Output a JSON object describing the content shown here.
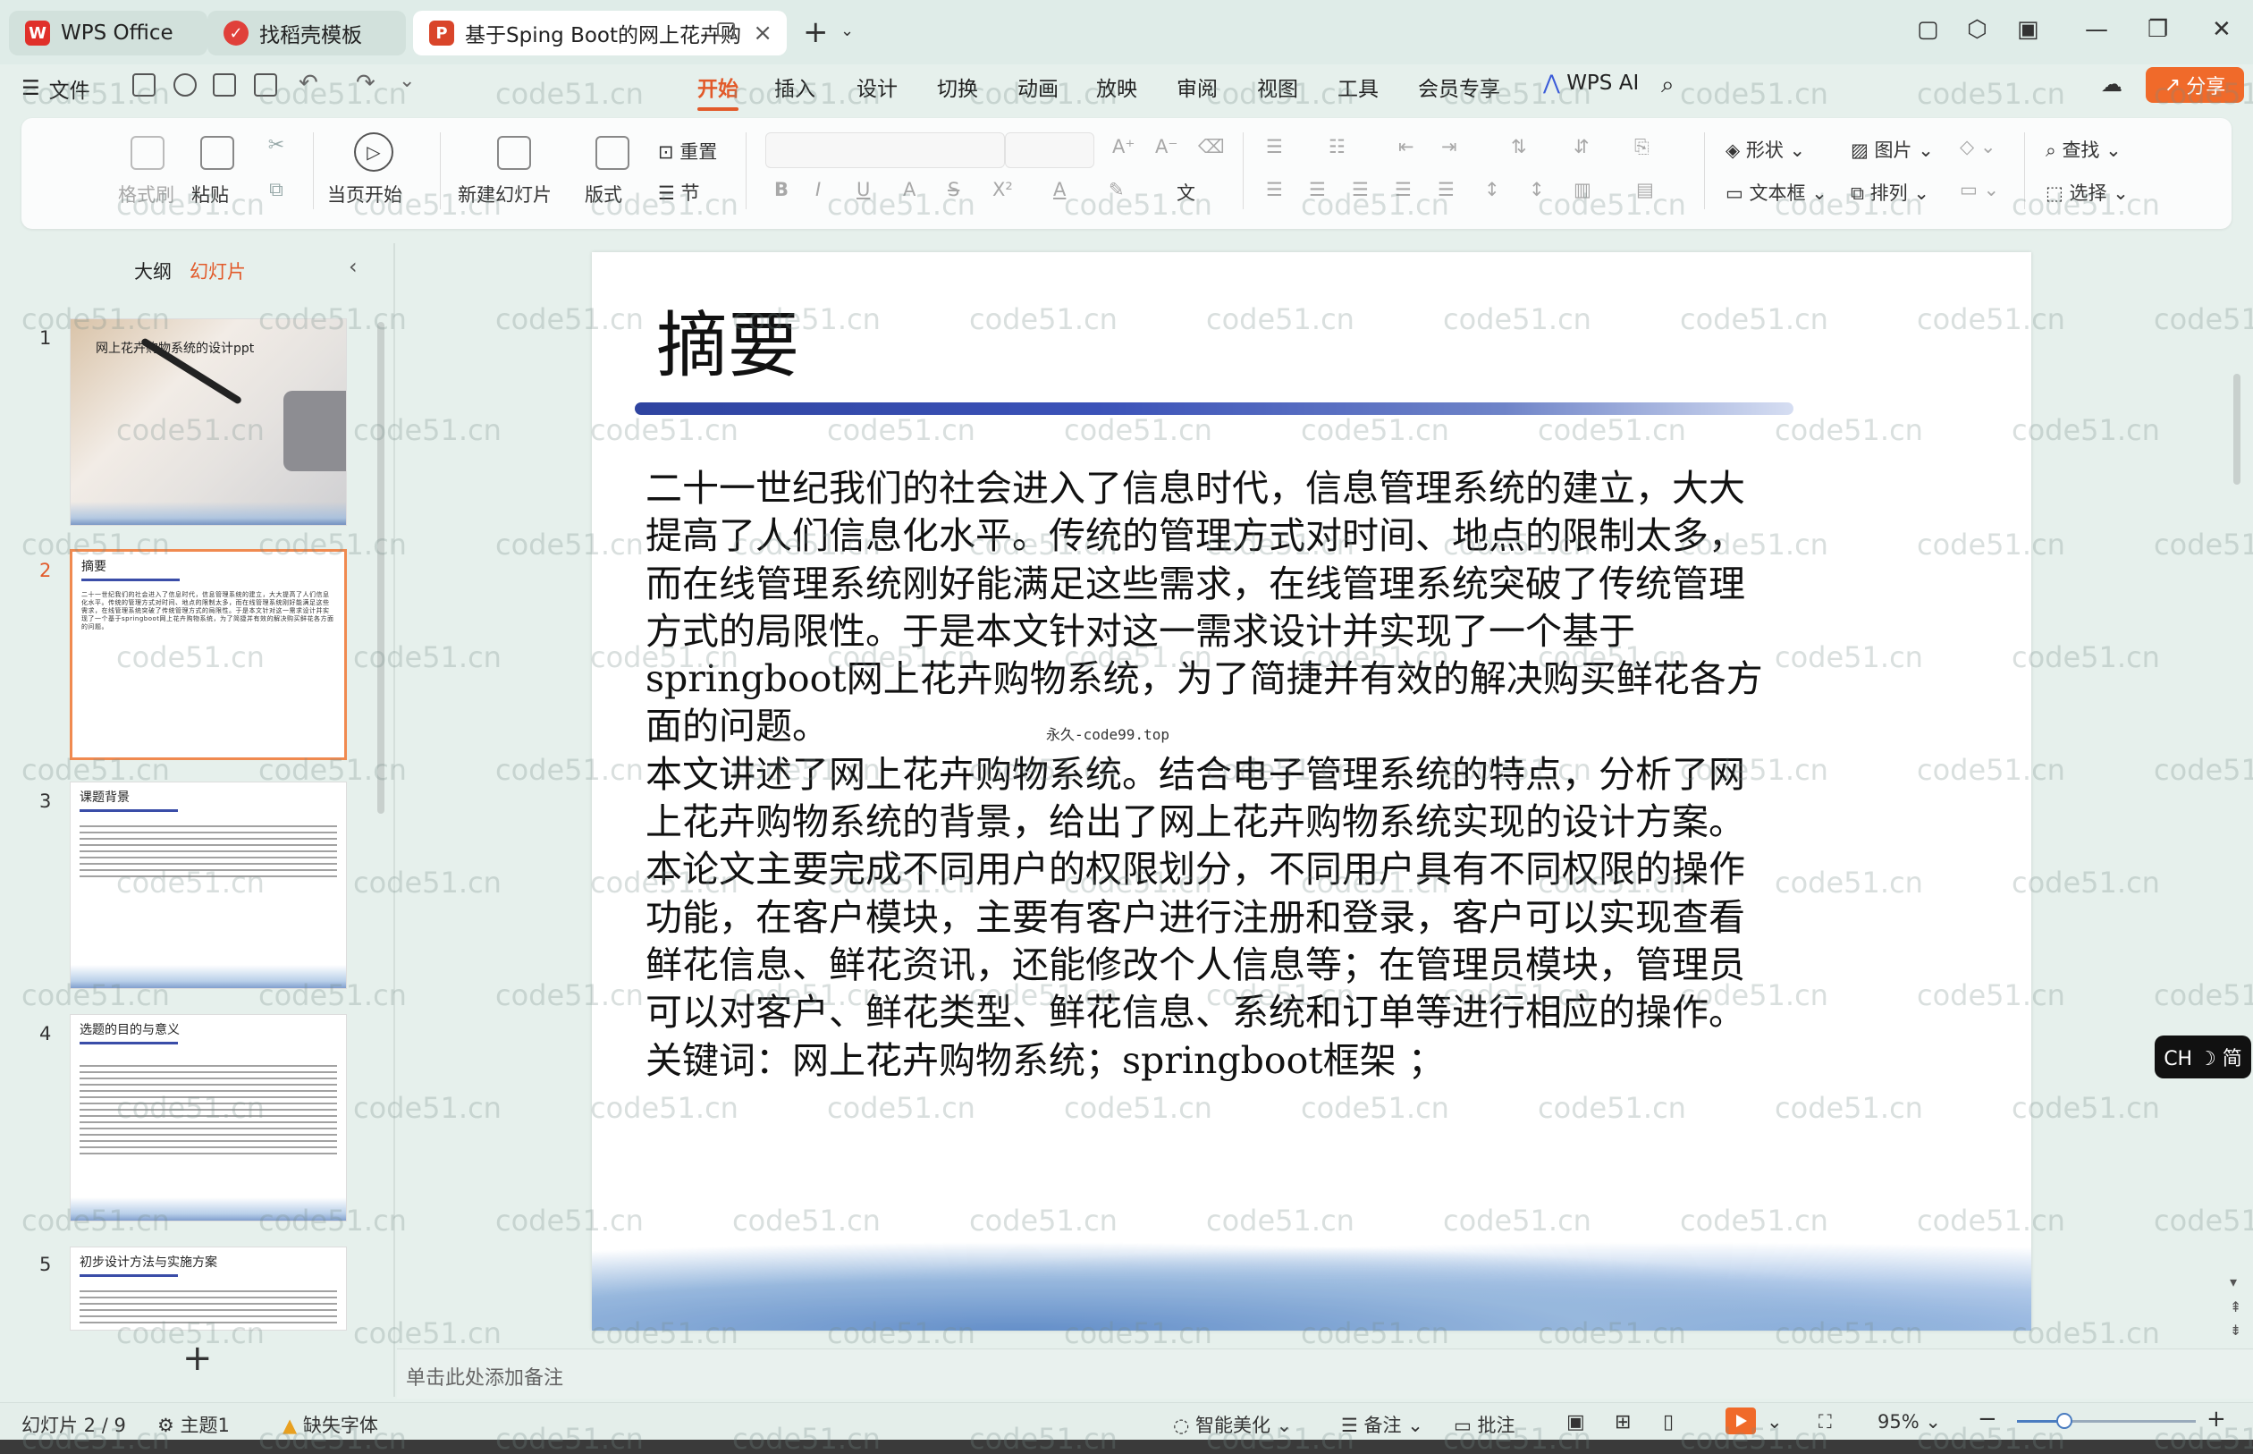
{
  "tabs": [
    {
      "label": "WPS Office",
      "icon": "wps-logo-icon"
    },
    {
      "label": "找稻壳模板",
      "icon": "docer-icon"
    },
    {
      "label": "基于Sping Boot的网上花卉购",
      "icon": "ppt-file-icon"
    }
  ],
  "menu": {
    "file_label": "文件",
    "tabs": [
      "开始",
      "插入",
      "设计",
      "切换",
      "动画",
      "放映",
      "审阅",
      "视图",
      "工具",
      "会员专享"
    ],
    "active_tab": "开始",
    "wps_ai": "WPS AI",
    "share": "分享"
  },
  "ribbon": {
    "format_painter": "格式刷",
    "paste": "粘贴",
    "play_from_current": "当页开始",
    "new_slide": "新建幻灯片",
    "layout": "版式",
    "reset": "重置",
    "section": "节",
    "text_direction": "A 文",
    "shape": "形状",
    "picture": "图片",
    "textbox": "文本框",
    "arrange": "排列",
    "find": "查找",
    "select": "选择"
  },
  "left_panel": {
    "tabs": [
      "大纲",
      "幻灯片"
    ],
    "active_tab": "幻灯片",
    "thumbnails": [
      {
        "num": "1",
        "title": "网上花卉购物系统的设计ppt"
      },
      {
        "num": "2",
        "title": "摘要"
      },
      {
        "num": "3",
        "title": "课题背景"
      },
      {
        "num": "4",
        "title": "选题的目的与意义"
      },
      {
        "num": "5",
        "title": "初步设计方法与实施方案"
      }
    ],
    "active_slide": "2"
  },
  "slide": {
    "title": "摘要",
    "paragraphs": [
      "二十一世纪我们的社会进入了信息时代，信息管理系统的建立，大大提高了人们信息化水平。传统的管理方式对时间、地点的限制太多，而在线管理系统刚好能满足这些需求，在线管理系统突破了传统管理方式的局限性。于是本文针对这一需求设计并实现了一个基于springboot网上花卉购物系统，为了简捷并有效的解决购买鲜花各方面的问题。",
      "本文讲述了网上花卉购物系统。结合电子管理系统的特点，分析了网上花卉购物系统的背景，给出了网上花卉购物系统实现的设计方案。",
      "本论文主要完成不同用户的权限划分，不同用户具有不同权限的操作功能，在客户模块，主要有客户进行注册和登录，客户可以实现查看鲜花信息、鲜花资讯，还能修改个人信息等；在管理员模块，管理员可以对客户、鲜花类型、鲜花信息、系统和订单等进行相应的操作。",
      "关键词：网上花卉购物系统；springboot框架 ；"
    ],
    "stamp": "永久-code99.top"
  },
  "notes_placeholder": "单击此处添加备注",
  "ime": "CH ☽ 简",
  "status": {
    "slide_count": "幻灯片 2 / 9",
    "theme": "主题1",
    "missing_font": "缺失字体",
    "beautify": "智能美化",
    "notes": "备注",
    "comments": "批注",
    "zoom": "95%",
    "zoom_fraction": 0.27
  },
  "watermark": "code51.cn"
}
